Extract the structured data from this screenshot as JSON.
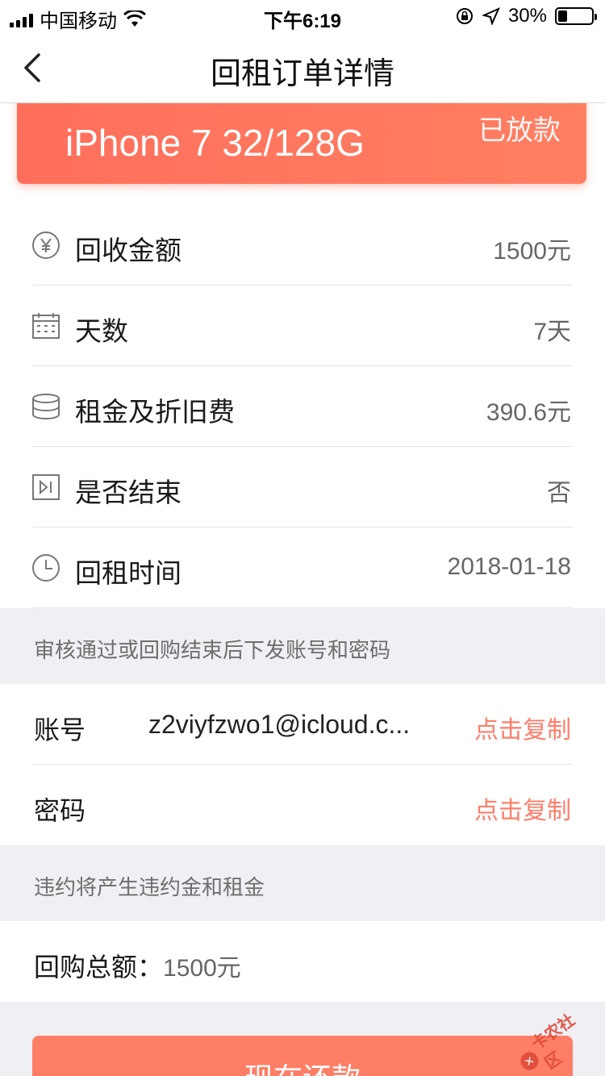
{
  "status_bar": {
    "carrier": "中国移动",
    "time": "下午6:19",
    "battery": "30%"
  },
  "nav": {
    "title": "回租订单详情"
  },
  "hero": {
    "model": "iPhone 7 32/128G",
    "status": "已放款"
  },
  "info_rows": [
    {
      "icon": "yen-circle-icon",
      "label": "回收金额",
      "value": "1500元"
    },
    {
      "icon": "calendar-icon",
      "label": "天数",
      "value": "7天"
    },
    {
      "icon": "coins-stack-icon",
      "label": "租金及折旧费",
      "value": "390.6元"
    },
    {
      "icon": "end-play-icon",
      "label": "是否结束",
      "value": "否"
    },
    {
      "icon": "clock-icon",
      "label": "回租时间",
      "value": "2018-01-18"
    }
  ],
  "notice1": "审核通过或回购结束后下发账号和密码",
  "account": {
    "label": "账号",
    "value": "z2viyfzwo1@icloud.c...",
    "copy": "点击复制"
  },
  "password": {
    "label": "密码",
    "value": "",
    "copy": "点击复制"
  },
  "notice2": "违约将产生违约金和租金",
  "total": {
    "label": "回购总额：",
    "value": "1500元"
  },
  "pay_button": "现在还款",
  "watermark": "卡农社区",
  "colors": {
    "accent": "#ff7e66",
    "gray_bg": "#efeff4",
    "hero_gradient_start": "#ff6f5c"
  }
}
